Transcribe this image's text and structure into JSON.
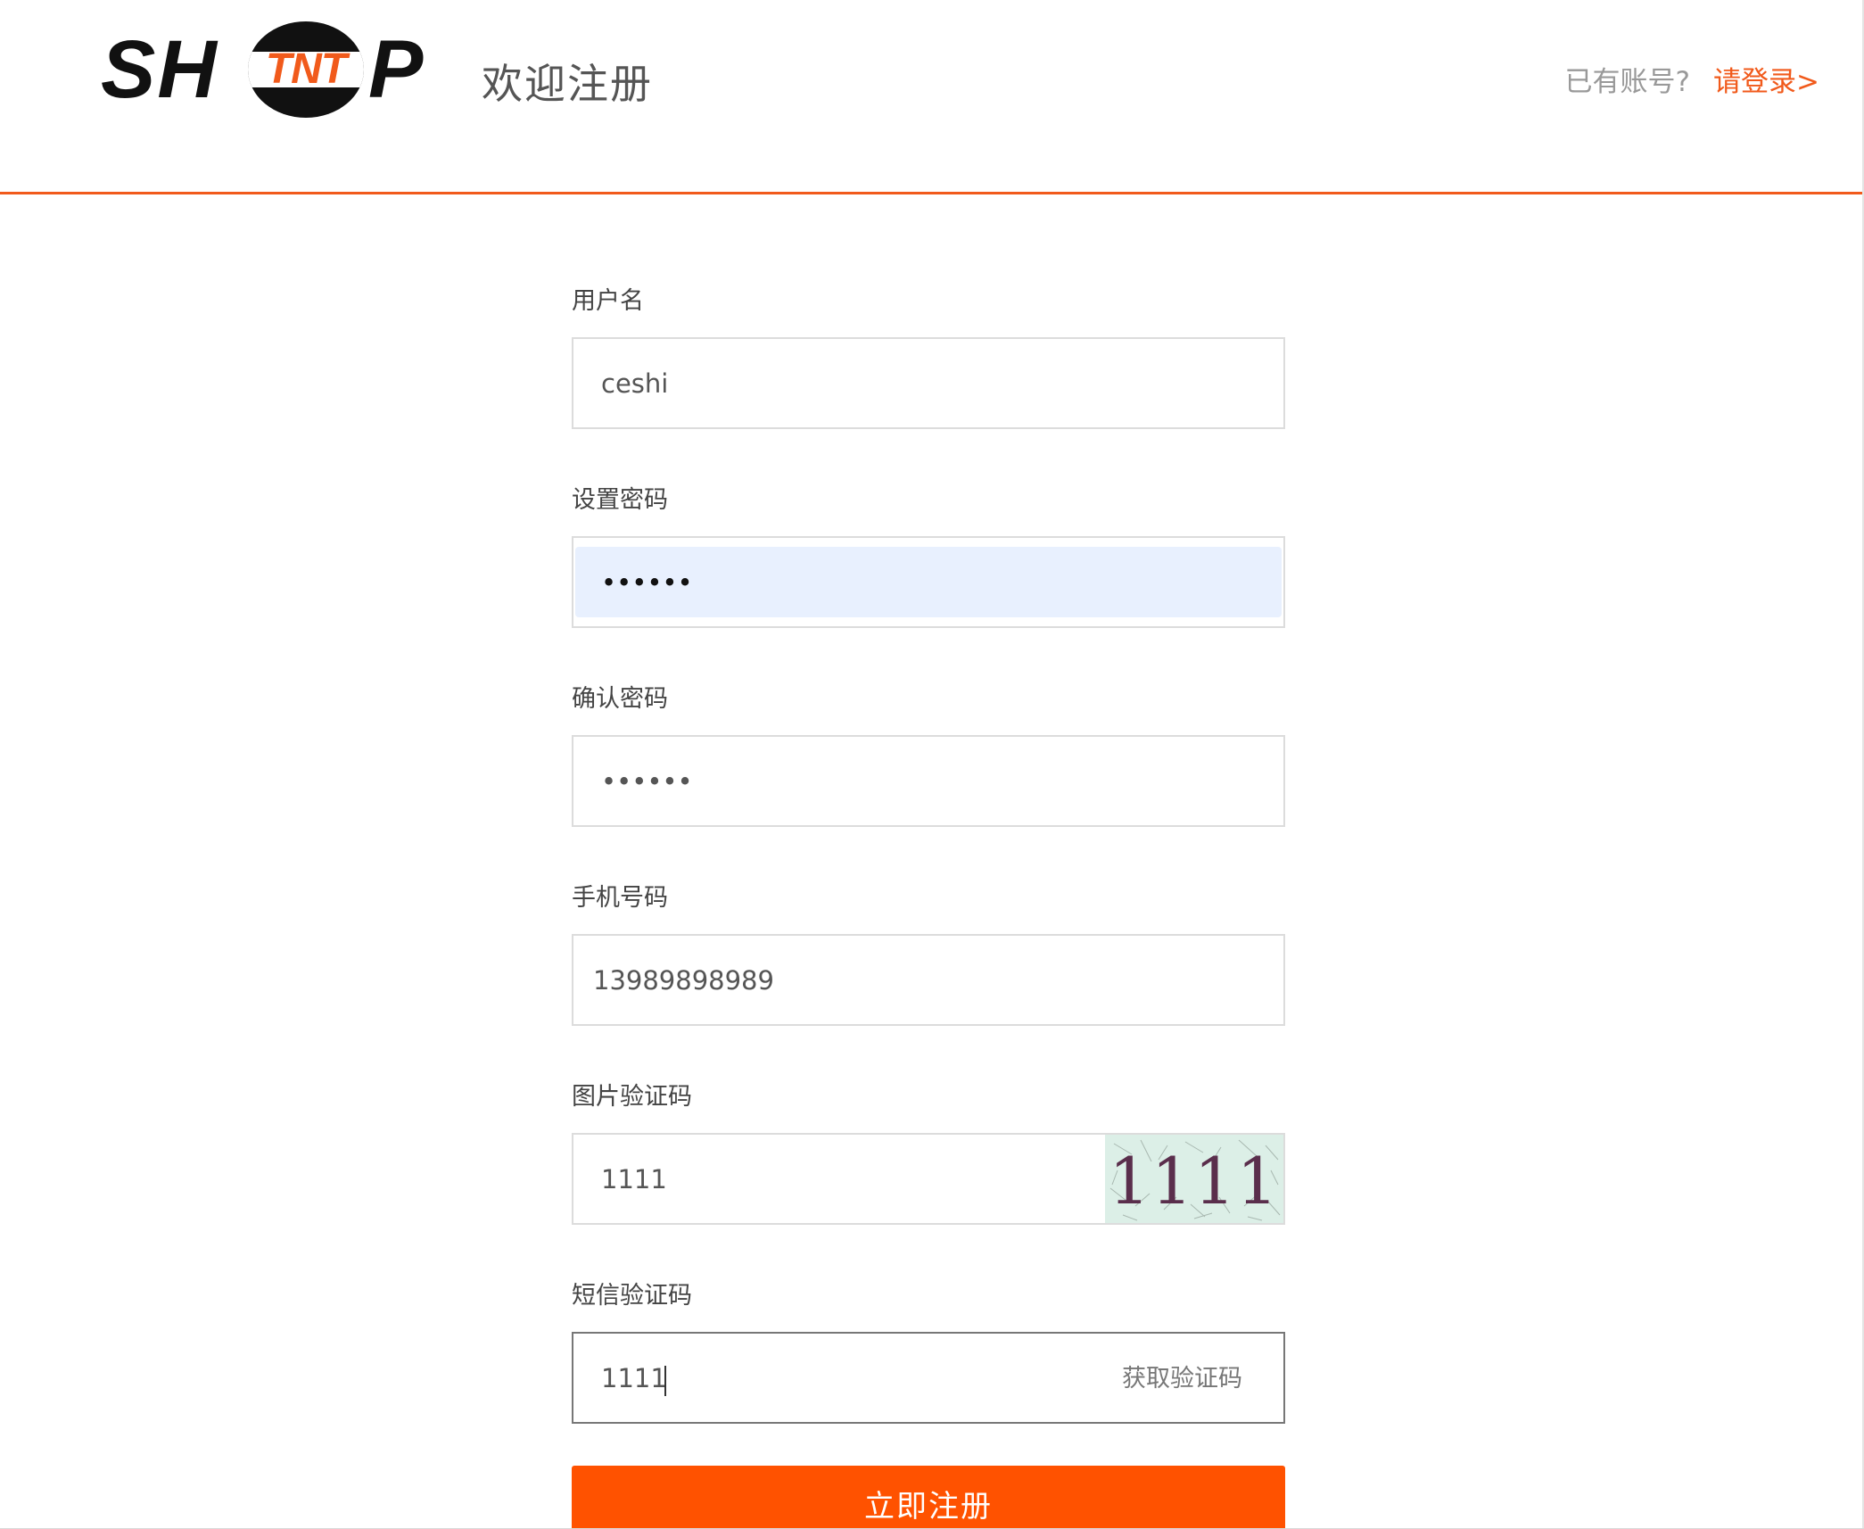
{
  "header": {
    "logo_letters_left": "SH",
    "logo_letters_mid": "TNT",
    "logo_letters_right": "P",
    "welcome": "欢迎注册",
    "have_account": "已有账号?",
    "login_link": "请登录>"
  },
  "form": {
    "username": {
      "label": "用户名",
      "value": "ceshi"
    },
    "password": {
      "label": "设置密码",
      "value": "••••••"
    },
    "confirm_password": {
      "label": "确认密码",
      "value": "••••••"
    },
    "phone": {
      "label": "手机号码",
      "value": "13989898989"
    },
    "image_captcha": {
      "label": "图片验证码",
      "value": "1111",
      "image_text": "1111"
    },
    "sms_code": {
      "label": "短信验证码",
      "value": "1111",
      "get_code": "获取验证码"
    }
  },
  "submit_label": "立即注册",
  "colors": {
    "accent": "#f15a1b",
    "button": "#ff5200",
    "autofill": "#e8f0fe"
  }
}
